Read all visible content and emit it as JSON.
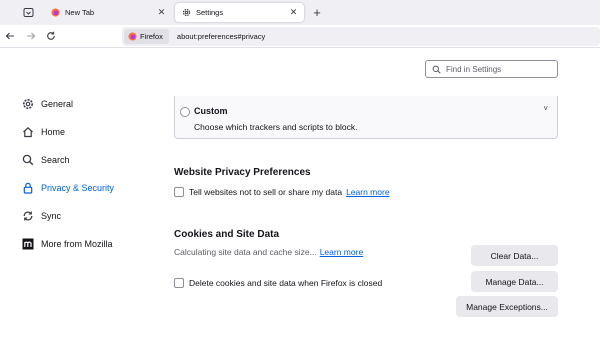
{
  "browser": {
    "tabs": [
      {
        "label": "New Tab",
        "icon": "firefox-icon",
        "active": false
      },
      {
        "label": "Settings",
        "icon": "gear-icon",
        "active": true
      }
    ],
    "identity_label": "Firefox",
    "url": "about:preferences#privacy"
  },
  "search": {
    "placeholder": "Find in Settings"
  },
  "sidebar": {
    "items": [
      {
        "label": "General",
        "icon": "gear-icon",
        "selected": false
      },
      {
        "label": "Home",
        "icon": "home-icon",
        "selected": false
      },
      {
        "label": "Search",
        "icon": "search-icon",
        "selected": false
      },
      {
        "label": "Privacy & Security",
        "icon": "lock-icon",
        "selected": true
      },
      {
        "label": "Sync",
        "icon": "sync-icon",
        "selected": false
      },
      {
        "label": "More from Mozilla",
        "icon": "mozilla-icon",
        "selected": false
      }
    ]
  },
  "tracking": {
    "custom_title": "Custom",
    "custom_desc": "Choose which trackers and scripts to block."
  },
  "website_privacy": {
    "title": "Website Privacy Preferences",
    "dnt_label": "Tell websites not to sell or share my data",
    "learn_more": "Learn more"
  },
  "cookies": {
    "title": "Cookies and Site Data",
    "calc_text": "Calculating site data and cache size...",
    "learn_more": "Learn more",
    "delete_label": "Delete cookies and site data when Firefox is closed",
    "clear_btn": "Clear Data...",
    "manage_btn": "Manage Data...",
    "exceptions_btn": "Manage Exceptions..."
  },
  "colors": {
    "accent": "#0061e0",
    "tabstrip": "#f0f0f4"
  }
}
